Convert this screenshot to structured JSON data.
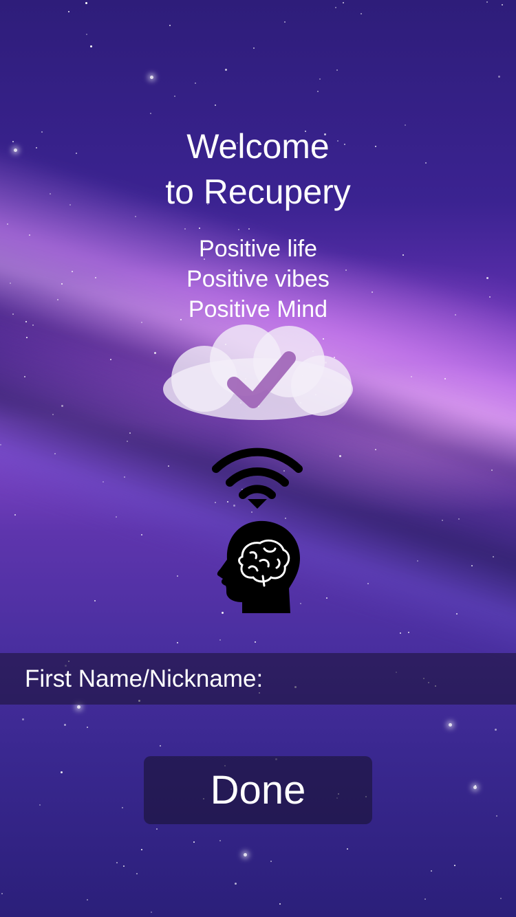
{
  "welcome": {
    "line1": "Welcome",
    "line2": "to Recupery"
  },
  "tagline": {
    "line1": "Positive life",
    "line2": "Positive vibes",
    "line3": "Positive Mind"
  },
  "icons": {
    "cloud": "cloud-check-icon",
    "signal": "wifi-signal-icon",
    "head": "brain-head-icon"
  },
  "name_field": {
    "label": "First Name/Nickname:",
    "value": "",
    "placeholder": ""
  },
  "done_button": {
    "label": "Done"
  },
  "colors": {
    "background_top": "#2e1d7a",
    "background_mid": "#8a4bcf",
    "check": "#9d62b6",
    "panel": "rgba(25,18,50,0.55)"
  }
}
